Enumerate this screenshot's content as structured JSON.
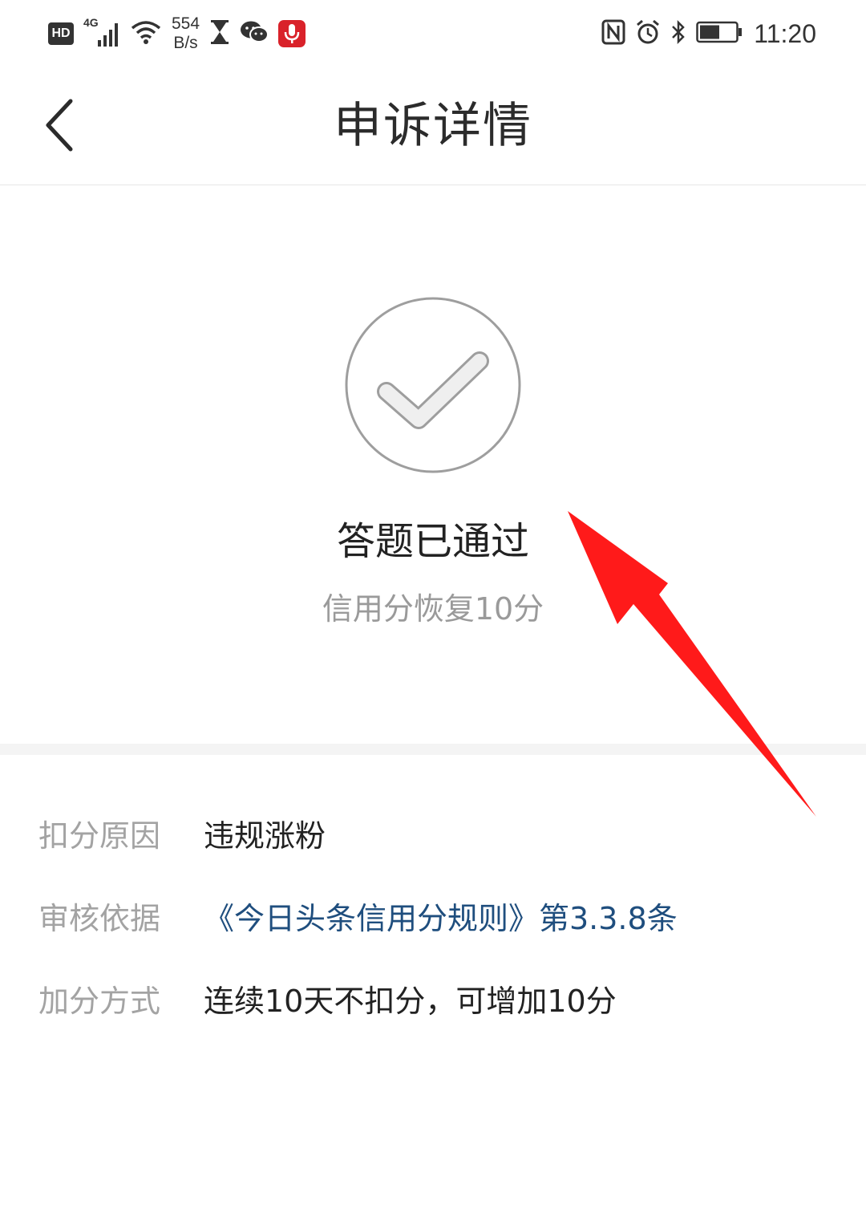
{
  "status_bar": {
    "hd_label": "HD",
    "network_type": "4G",
    "net_speed_value": "554",
    "net_speed_unit": "B/s",
    "time": "11:20",
    "icons": [
      "hd-badge",
      "signal-icon",
      "wifi-icon",
      "hourglass-icon",
      "wechat-icon",
      "mic-icon",
      "nfc-icon",
      "alarm-icon",
      "bluetooth-icon",
      "battery-icon"
    ],
    "mic_color": "#d9222a"
  },
  "header": {
    "title": "申诉详情",
    "back_icon": "chevron-left-icon"
  },
  "result": {
    "icon": "check-circle-icon",
    "title": "答题已通过",
    "subtitle": "信用分恢复10分"
  },
  "details": [
    {
      "label": "扣分原因",
      "value": "违规涨粉",
      "is_link": false
    },
    {
      "label": "审核依据",
      "value": "《今日头条信用分规则》第3.3.8条",
      "is_link": true
    },
    {
      "label": "加分方式",
      "value": "连续10天不扣分，可增加10分",
      "is_link": false
    }
  ],
  "annotation": {
    "type": "arrow",
    "color": "#ff1a1a"
  },
  "colors": {
    "link": "#1f4e7e",
    "label": "#a3a3a3",
    "text": "#222222",
    "muted": "#9a9a9a"
  }
}
